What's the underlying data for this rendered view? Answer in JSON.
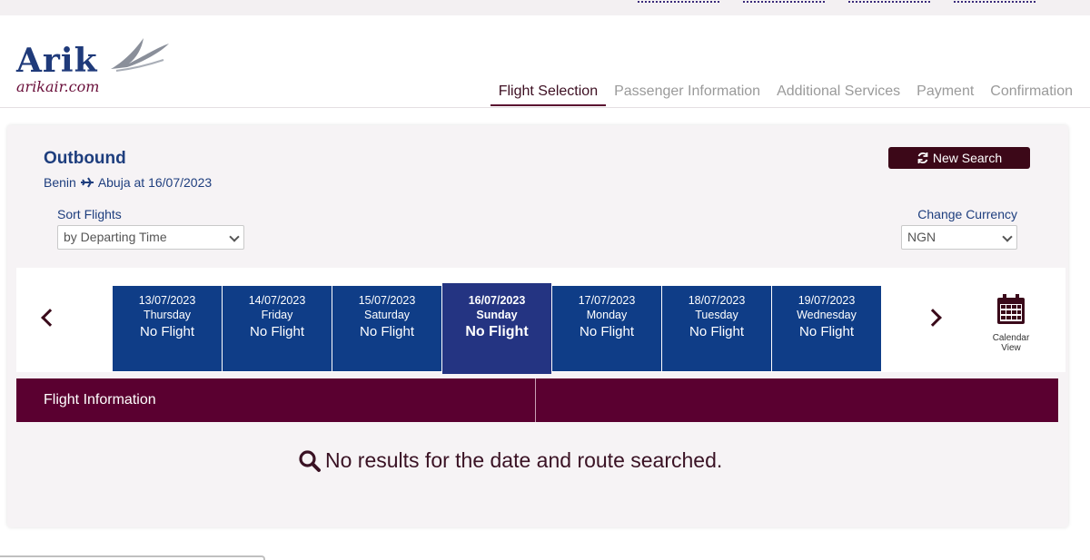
{
  "brand": {
    "name": "Arik",
    "domain": "arikair.com",
    "primary_color": "#1e3e7e",
    "accent_color": "#5a0030"
  },
  "steps": [
    {
      "label": "Flight Selection",
      "active": true
    },
    {
      "label": "Passenger Information",
      "active": false
    },
    {
      "label": "Additional Services",
      "active": false
    },
    {
      "label": "Payment",
      "active": false
    },
    {
      "label": "Confirmation",
      "active": false
    }
  ],
  "outbound": {
    "title": "Outbound",
    "origin": "Benin",
    "destination": "Abuja at 16/07/2023",
    "new_search_label": "New Search"
  },
  "sort": {
    "label": "Sort Flights",
    "selected": "by Departing Time"
  },
  "currency": {
    "label": "Change Currency",
    "selected": "NGN"
  },
  "dates": [
    {
      "date": "13/07/2023",
      "day": "Thursday",
      "status": "No Flight",
      "active": false
    },
    {
      "date": "14/07/2023",
      "day": "Friday",
      "status": "No Flight",
      "active": false
    },
    {
      "date": "15/07/2023",
      "day": "Saturday",
      "status": "No Flight",
      "active": false
    },
    {
      "date": "16/07/2023",
      "day": "Sunday",
      "status": "No Flight",
      "active": true
    },
    {
      "date": "17/07/2023",
      "day": "Monday",
      "status": "No Flight",
      "active": false
    },
    {
      "date": "18/07/2023",
      "day": "Tuesday",
      "status": "No Flight",
      "active": false
    },
    {
      "date": "19/07/2023",
      "day": "Wednesday",
      "status": "No Flight",
      "active": false
    }
  ],
  "calendar_view": {
    "line1": "Calendar",
    "line2": "View",
    "icon": "calendar-icon"
  },
  "info": {
    "header": "Flight Information"
  },
  "results": {
    "message": "No results for the date and route searched.",
    "icon": "search-icon"
  }
}
